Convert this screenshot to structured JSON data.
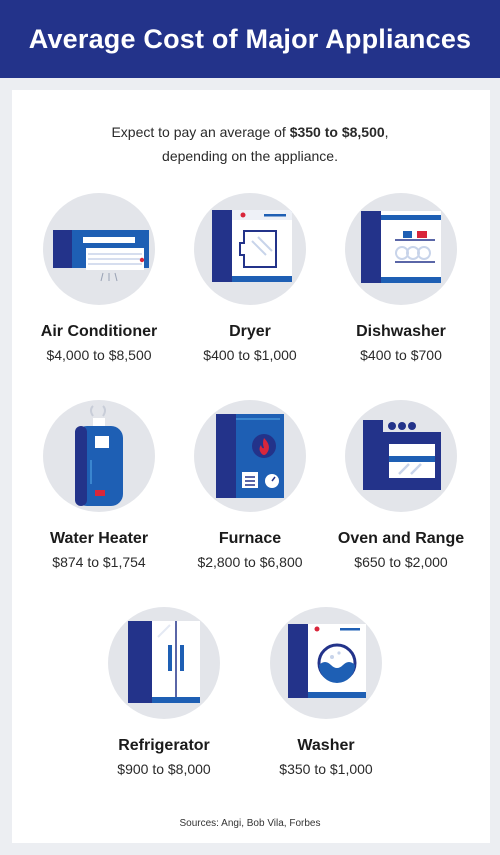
{
  "title": "Average Cost of Major Appliances",
  "intro": {
    "line1_prefix": "Expect to pay an average of ",
    "line1_bold": "$350 to $8,500",
    "line1_suffix": ",",
    "line2": "depending on the appliance."
  },
  "colors": {
    "header": "#23338a",
    "navy": "#23338a",
    "blue": "#1e5fb4",
    "light_blue": "#3a86cf",
    "red": "#d9263b",
    "circle": "#e3e5ea"
  },
  "appliances": [
    {
      "name": "Air Conditioner",
      "price": "$4,000 to $8,500",
      "icon": "air-conditioner-icon"
    },
    {
      "name": "Dryer",
      "price": "$400 to $1,000",
      "icon": "dryer-icon"
    },
    {
      "name": "Dishwasher",
      "price": "$400 to $700",
      "icon": "dishwasher-icon"
    },
    {
      "name": "Water Heater",
      "price": "$874 to $1,754",
      "icon": "water-heater-icon"
    },
    {
      "name": "Furnace",
      "price": "$2,800 to $6,800",
      "icon": "furnace-icon"
    },
    {
      "name": "Oven and Range",
      "price": "$650 to $2,000",
      "icon": "oven-range-icon"
    },
    {
      "name": "Refrigerator",
      "price": "$900 to $8,000",
      "icon": "refrigerator-icon"
    },
    {
      "name": "Washer",
      "price": "$350 to $1,000",
      "icon": "washer-icon"
    }
  ],
  "sources": "Sources: Angi, Bob Vila, Forbes"
}
